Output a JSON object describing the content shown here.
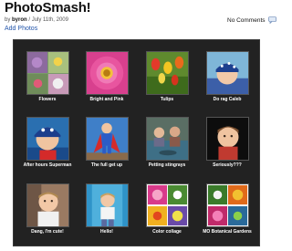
{
  "post": {
    "title": "PhotoSmash!",
    "by_prefix": "by ",
    "author": "byron",
    "date_sep": " / ",
    "date": "July 11th, 2009",
    "comments": "No Comments",
    "add_photos": "Add Photos"
  },
  "gallery": {
    "photos": [
      {
        "caption": "Flowers"
      },
      {
        "caption": "Bright and Pink"
      },
      {
        "caption": "Tulips"
      },
      {
        "caption": "Do rag Caleb"
      },
      {
        "caption": "After hours Superman"
      },
      {
        "caption": "The full get up"
      },
      {
        "caption": "Petting stingrays"
      },
      {
        "caption": "Seriously???"
      },
      {
        "caption": "Dang, I'm cute!"
      },
      {
        "caption": "Hello!"
      },
      {
        "caption": "Color collage"
      },
      {
        "caption": "MO Botanical Gardens"
      }
    ]
  },
  "icons": {
    "comments": "speech-bubble-icon"
  },
  "colors": {
    "link": "#2255aa",
    "gallery_bg": "#222222"
  }
}
